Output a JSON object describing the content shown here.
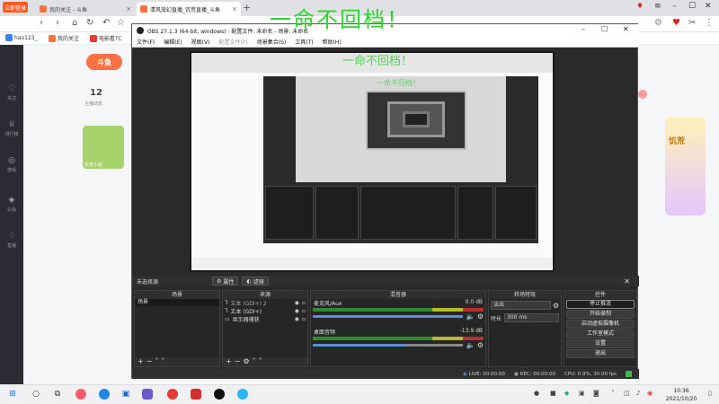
{
  "browser": {
    "live_badge": "立即登录",
    "tabs": [
      {
        "label": "我的关注 - 斗鱼",
        "active": false
      },
      {
        "label": "清风旅幻直播_饥荒直播_斗鱼",
        "active": true
      }
    ],
    "bookmarks": [
      "hao123_",
      "我的关注",
      "电影看TC"
    ]
  },
  "douyu": {
    "logo": "斗鱼",
    "count": "12",
    "count_label": "主播动态",
    "thumb_label": "饥荒小屋",
    "side_label": "饥荒",
    "nav": [
      "关注",
      "排行榜",
      "游戏",
      "公会",
      "直播"
    ]
  },
  "obs": {
    "title": "OBS 27.1.3 (64-bit, windows) - 配置文件: 未命名 - 场景: 未命名",
    "menu": [
      "文件(F)",
      "编辑(E)",
      "视图(V)",
      "配置文件(P)",
      "场景集合(S)",
      "工具(T)",
      "帮助(H)"
    ],
    "overlay_text": "一命不回档！",
    "no_source": "未选择源",
    "props_btn": "属性",
    "filters_btn": "滤镜",
    "scenes_header": "场景",
    "scenes": [
      "场景"
    ],
    "sources_header": "来源",
    "sources": [
      "文本 (GDI+) 2",
      "文本 (GDI+)",
      "显示器捕获"
    ],
    "mixer_header": "混音器",
    "mixer": [
      {
        "name": "麦克风/Aux",
        "db": "0.0 dB"
      },
      {
        "name": "桌面音频",
        "db": "-13.9 dB"
      }
    ],
    "transition_header": "转场特效",
    "transition_type": "淡出",
    "duration_label": "时长",
    "duration_value": "300 ms",
    "controls_header": "控件",
    "controls": [
      "停止推流",
      "开始录制",
      "启动虚拟摄像机",
      "工作室模式",
      "设置",
      "退出"
    ],
    "status": {
      "live": "LIVE: 00:00:00",
      "rec": "REC: 00:00:00",
      "cpu": "CPU: 0.9%, 30.00 fps"
    }
  },
  "taskbar": {
    "time": "10:36",
    "date": "2021/10/20"
  },
  "colors": {
    "obs_bg": "#2a2a2a",
    "overlay_green": "#2fd52f",
    "douyu_orange": "#ff7043"
  }
}
